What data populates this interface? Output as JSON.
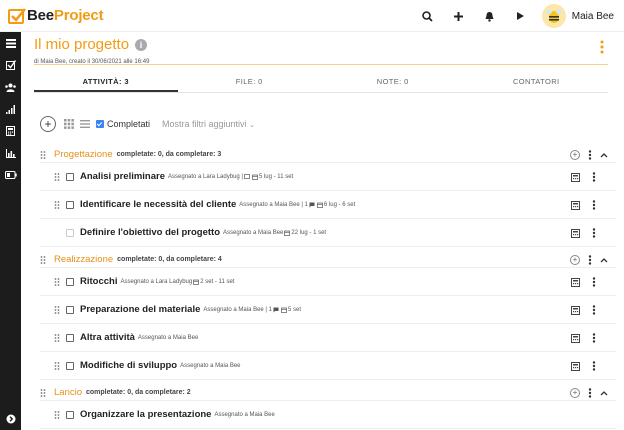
{
  "app": {
    "logo_text_bee": "Bee",
    "logo_text_project": "Project",
    "user_name": "Maia Bee"
  },
  "sidebar": {
    "items": [
      "dashboard-icon",
      "check-icon",
      "users-icon",
      "signal-icon",
      "calculator-icon",
      "bar-chart-icon",
      "battery-icon"
    ],
    "bottom": "chevron-right-icon"
  },
  "page": {
    "title": "Il mio progetto",
    "subtitle": "di Maia Bee, creato il 30/06/2021 alle 16:49"
  },
  "tabs": [
    {
      "label": "ATTIVITÀ: 3",
      "active": true
    },
    {
      "label": "FILE: 0",
      "active": false
    },
    {
      "label": "NOTE: 0",
      "active": false
    },
    {
      "label": "CONTATORI",
      "active": false
    }
  ],
  "toolbar": {
    "completed_label": "Completati",
    "completed_checked": true,
    "filters_label": "Mostra filtri aggiuntivi"
  },
  "groups": [
    {
      "name": "Progettazione",
      "stats": "completate: 0, da completare: 3",
      "tasks": [
        {
          "name": "Analisi preliminare",
          "assigned": "Assegnato a Lara Ladybug |",
          "meta": "5 lug - 11 set"
        },
        {
          "name": "Identificare le necessità del cliente",
          "assigned": "Assegnato a Maia Bee | 1",
          "meta": "6 lug - 6 set"
        },
        {
          "name": "Definire l'obiettivo del progetto",
          "assigned": "Assegnato a Maia Bee",
          "meta": "22 lug - 1 set"
        }
      ]
    },
    {
      "name": "Realizzazione",
      "stats": "completate: 0, da completare: 4",
      "tasks": [
        {
          "name": "Ritocchi",
          "assigned": "Assegnato a Lara Ladybug",
          "meta": "2 set - 11 set"
        },
        {
          "name": "Preparazione del materiale",
          "assigned": "Assegnato a Maia Bee | 1",
          "meta": "5 set"
        },
        {
          "name": "Altra attività",
          "assigned": "Assegnato a Maia Bee",
          "meta": ""
        },
        {
          "name": "Modifiche di sviluppo",
          "assigned": "Assegnato a Maia Bee",
          "meta": ""
        }
      ]
    },
    {
      "name": "Lancio",
      "stats": "completate: 0, da completare: 2",
      "tasks": [
        {
          "name": "Organizzare la presentazione",
          "assigned": "Assegnato a Maia Bee",
          "meta": ""
        }
      ]
    }
  ],
  "colors": {
    "accent": "#f39c12",
    "sidebar": "#1c1c1c",
    "checkbox": "#3b82f6"
  }
}
